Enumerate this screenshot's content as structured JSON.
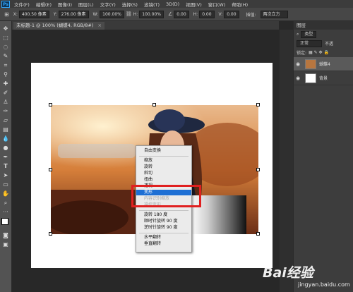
{
  "app": {
    "logo": "Ps",
    "menus": [
      "文件(F)",
      "编辑(E)",
      "图像(I)",
      "图层(L)",
      "文字(Y)",
      "选择(S)",
      "滤镜(T)",
      "3D(D)",
      "视图(V)",
      "窗口(W)",
      "帮助(H)"
    ]
  },
  "options": {
    "x_label": "X:",
    "x_value": "400.50 像素",
    "y_label": "Y:",
    "y_value": "276.00 像素",
    "w_label": "W:",
    "w_value": "100.00%",
    "h_label": "H:",
    "h_value": "100.00%",
    "angle_value": "0.00",
    "h_skew_label": "H:",
    "h_skew_value": "0.00",
    "v_skew_label": "V:",
    "v_skew_value": "0.00",
    "interp_label": "插值:",
    "interp_value": "两次立方"
  },
  "document": {
    "tab_title": "未标题-1 @ 100% (蝴蝶4, RGB/8#)",
    "tab_close": "×"
  },
  "context_menu": {
    "items": [
      {
        "label": "自由变换",
        "state": "normal"
      },
      {
        "label": "缩放",
        "state": "normal"
      },
      {
        "label": "旋转",
        "state": "normal"
      },
      {
        "label": "斜切",
        "state": "normal"
      },
      {
        "label": "扭曲",
        "state": "normal"
      },
      {
        "label": "透视",
        "state": "normal"
      },
      {
        "label": "变形",
        "state": "active"
      },
      {
        "label": "内容识别缩放",
        "state": "disabled"
      },
      {
        "label": "操控变形",
        "state": "disabled"
      },
      {
        "label": "旋转 180 度",
        "state": "normal"
      },
      {
        "label": "顺时针旋转 90 度",
        "state": "normal"
      },
      {
        "label": "逆时针旋转 90 度",
        "state": "normal"
      },
      {
        "label": "水平翻转",
        "state": "normal"
      },
      {
        "label": "垂直翻转",
        "state": "normal"
      }
    ]
  },
  "layers_panel": {
    "title": "图层",
    "filter_value": "类型",
    "blend_mode": "正常",
    "opacity_label": "不透",
    "lock_label": "锁定:",
    "layers": [
      {
        "name": "蝴蝶4",
        "selected": true
      },
      {
        "name": "背景",
        "selected": false
      }
    ]
  },
  "watermark": {
    "brand": "Bai经验",
    "url": "jingyan.baidu.com"
  },
  "colors": {
    "highlight": "#1e6fd4",
    "annotation_red": "#e02020"
  }
}
